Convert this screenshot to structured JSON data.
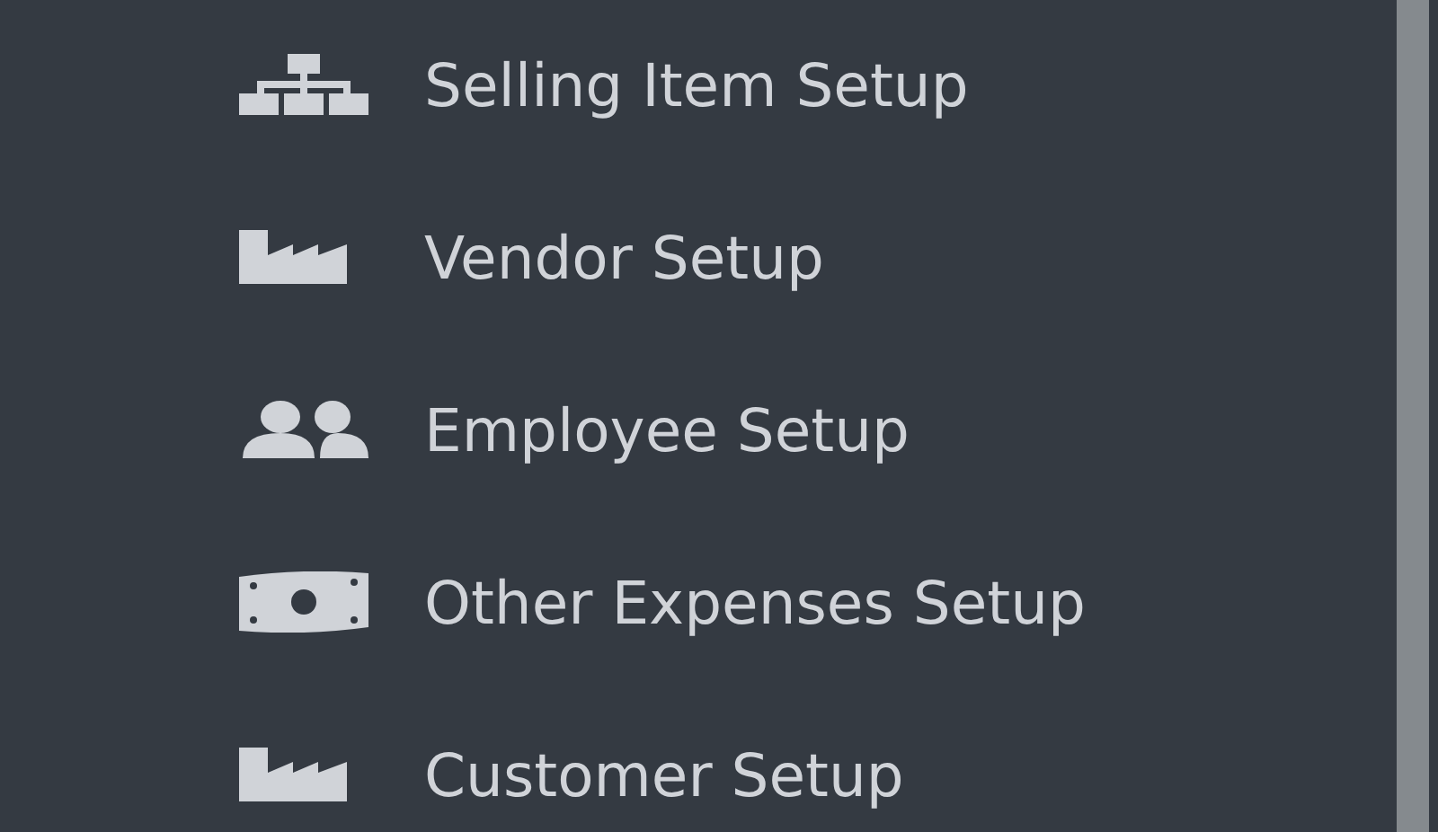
{
  "menu": {
    "items": [
      {
        "label": "Selling Item Setup",
        "kind": "sitemap"
      },
      {
        "label": "Vendor Setup",
        "kind": "factory"
      },
      {
        "label": "Employee Setup",
        "kind": "users"
      },
      {
        "label": "Other Expenses Setup",
        "kind": "money"
      },
      {
        "label": "Customer Setup",
        "kind": "factory"
      }
    ]
  }
}
